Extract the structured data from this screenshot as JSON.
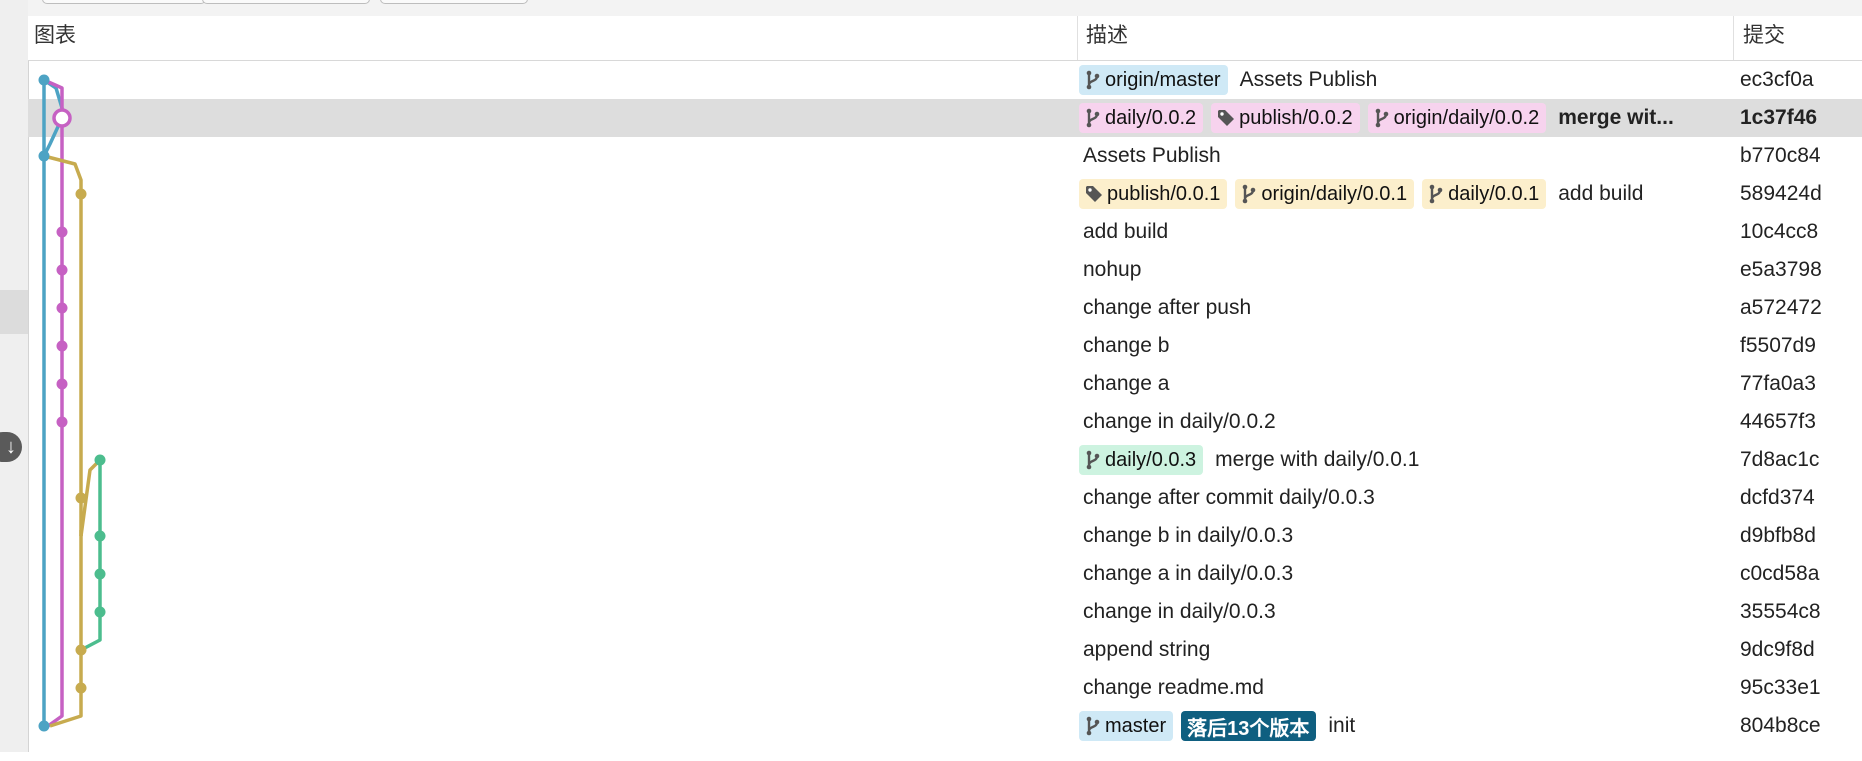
{
  "header": {
    "graph": "图表",
    "description": "描述",
    "commit": "提交"
  },
  "commits": [
    {
      "hash": "ec3cf0a",
      "refs": [
        {
          "name": "origin/master",
          "kind": "branch",
          "color": "blue"
        }
      ],
      "message": "Assets Publish",
      "selected": false
    },
    {
      "hash": "1c37f46",
      "refs": [
        {
          "name": "daily/0.0.2",
          "kind": "branch",
          "color": "pink"
        },
        {
          "name": "publish/0.0.2",
          "kind": "tag",
          "color": "pink"
        },
        {
          "name": "origin/daily/0.0.2",
          "kind": "branch",
          "color": "pink"
        }
      ],
      "message": "merge wit...",
      "selected": true
    },
    {
      "hash": "b770c84",
      "refs": [],
      "message": "Assets Publish",
      "selected": false
    },
    {
      "hash": "589424d",
      "refs": [
        {
          "name": "publish/0.0.1",
          "kind": "tag",
          "color": "yellow"
        },
        {
          "name": "origin/daily/0.0.1",
          "kind": "branch",
          "color": "yellow"
        },
        {
          "name": "daily/0.0.1",
          "kind": "branch",
          "color": "yellow"
        }
      ],
      "message": "add build",
      "selected": false
    },
    {
      "hash": "10c4cc8",
      "refs": [],
      "message": "add build",
      "selected": false
    },
    {
      "hash": "e5a3798",
      "refs": [],
      "message": "nohup",
      "selected": false
    },
    {
      "hash": "a572472",
      "refs": [],
      "message": "change after push",
      "selected": false
    },
    {
      "hash": "f5507d9",
      "refs": [],
      "message": "change b",
      "selected": false
    },
    {
      "hash": "77fa0a3",
      "refs": [],
      "message": "change a",
      "selected": false
    },
    {
      "hash": "44657f3",
      "refs": [],
      "message": "change in daily/0.0.2",
      "selected": false
    },
    {
      "hash": "7d8ac1c",
      "refs": [
        {
          "name": "daily/0.0.3",
          "kind": "branch",
          "color": "green"
        }
      ],
      "message": "merge with daily/0.0.1",
      "selected": false
    },
    {
      "hash": "dcfd374",
      "refs": [],
      "message": "change after commit daily/0.0.3",
      "selected": false
    },
    {
      "hash": "d9bfb8d",
      "refs": [],
      "message": "change b in daily/0.0.3",
      "selected": false
    },
    {
      "hash": "c0cd58a",
      "refs": [],
      "message": "change a in daily/0.0.3",
      "selected": false
    },
    {
      "hash": "35554c8",
      "refs": [],
      "message": "change in daily/0.0.3",
      "selected": false
    },
    {
      "hash": "9dc9f8d",
      "refs": [],
      "message": "append string",
      "selected": false
    },
    {
      "hash": "95c33e1",
      "refs": [],
      "message": "change readme.md",
      "selected": false
    },
    {
      "hash": "804b8ce",
      "refs": [
        {
          "name": "master",
          "kind": "branch",
          "color": "blue"
        },
        {
          "name": "落后13个版本",
          "kind": "behind",
          "color": "dark"
        }
      ],
      "message": "init",
      "selected": false
    }
  ],
  "graph": {
    "lane_colors": {
      "blue": "#4da3c4",
      "pink": "#c661c3",
      "yellow": "#c7ab4f",
      "green": "#4cbd8e"
    }
  },
  "colors": {
    "selected_row": "#dddddd",
    "behind_badge": "#0f5f80"
  },
  "icons": {
    "branch": "branch-icon",
    "tag": "tag-icon",
    "scroll": "arrow-down-icon"
  }
}
